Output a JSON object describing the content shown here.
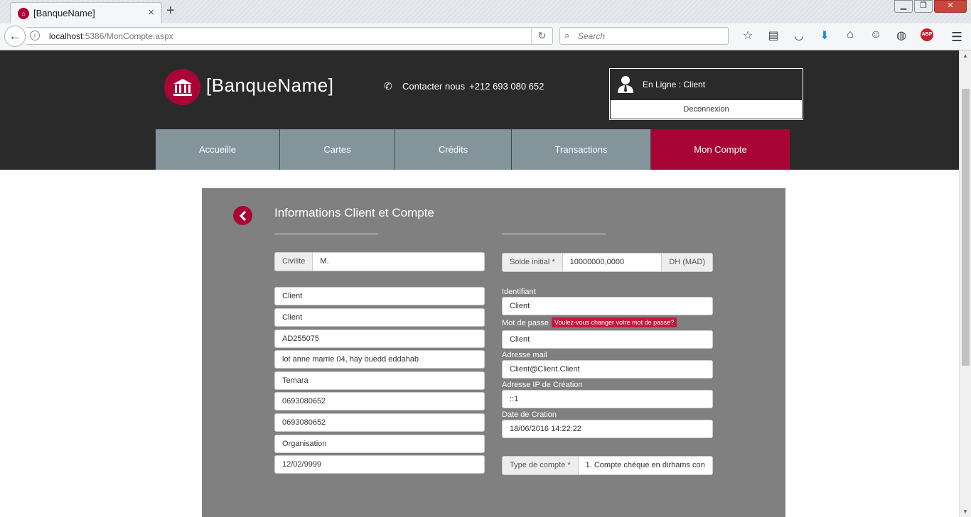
{
  "browser": {
    "tab_title": "[BanqueName]",
    "tab_close": "×",
    "new_tab": "+",
    "url_host": "localhost",
    "url_rest": ":5386/MonCompte.aspx",
    "search_placeholder": "Search",
    "abp_label": "ABP",
    "win_min": "▁",
    "win_max": "❐",
    "win_close": "✕"
  },
  "header": {
    "brand": "[BanqueName]",
    "contact_label": "Contacter nous",
    "contact_phone": "+212 693 080 652",
    "online_status": "En Ligne : Client",
    "logout_label": "Deconnexion"
  },
  "menu": [
    {
      "label": "Accueille"
    },
    {
      "label": "Cartes"
    },
    {
      "label": "Crédits"
    },
    {
      "label": "Transactions"
    },
    {
      "label": "Mon Compte"
    }
  ],
  "panel": {
    "title": "Informations Client et Compte",
    "civilite_label": "Civilite",
    "civilite_value": "M.",
    "left_fields": [
      "Client",
      "Client",
      "AD255075",
      "lot anne marrie 04, hay ouedd eddahab",
      "Temara",
      "0693080652",
      "0693080652",
      "Organisation",
      "12/02/9999"
    ],
    "solde_label": "Solde initial *",
    "solde_value": "10000000,0000",
    "solde_unit": "DH (MAD)",
    "identifiant_label": "Identifiant",
    "identifiant_value": "Client",
    "password_label": "Mot de passe",
    "password_badge": "Voulez-vous changer votre mot de passe?",
    "password_value": "Client",
    "email_label": "Adresse mail",
    "email_value": "Client@Client.Client",
    "ip_label": "Adresse IP de Création",
    "ip_value": "::1",
    "date_label": "Date de Cration",
    "date_value": "18/06/2016 14:22:22",
    "type_label": "Type de compte *",
    "type_value": "1. Compte chèque en dirhams con"
  },
  "colors": {
    "brand": "#a80536",
    "header_bg": "#2a2a2a",
    "menu_bg": "#84949b",
    "panel_bg": "#808080",
    "badge": "#c4183c"
  }
}
